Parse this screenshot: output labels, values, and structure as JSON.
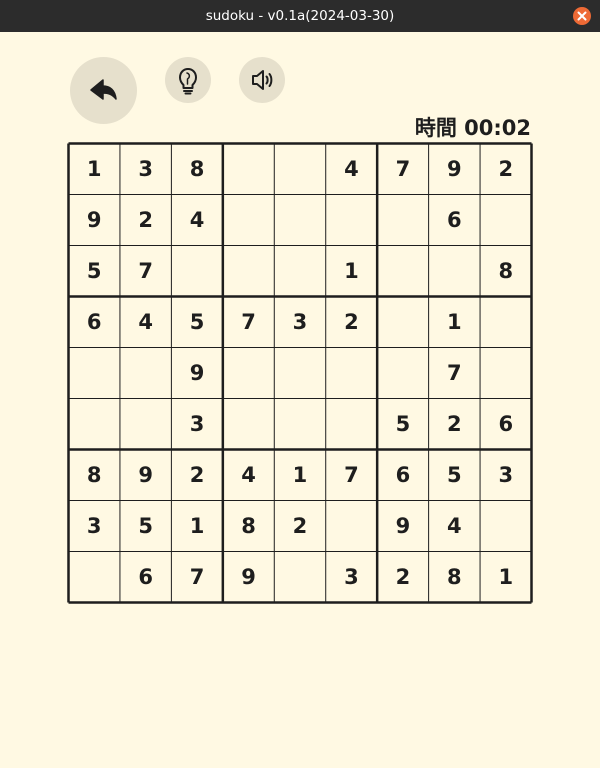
{
  "window": {
    "title": "sudoku - v0.1a(2024-03-30)"
  },
  "toolbar": {
    "back_icon": "undo-arrow-icon",
    "hint_icon": "lightbulb-icon",
    "sound_icon": "speaker-icon"
  },
  "timer": {
    "label": "時間",
    "value": "00:02",
    "display": "時間 00:02"
  },
  "board": {
    "size": 9,
    "rows": [
      [
        "1",
        "3",
        "8",
        "",
        "",
        "4",
        "7",
        "9",
        "2"
      ],
      [
        "9",
        "2",
        "4",
        "",
        "",
        "",
        "",
        "6",
        ""
      ],
      [
        "5",
        "7",
        "",
        "",
        "",
        "1",
        "",
        "",
        "8"
      ],
      [
        "6",
        "4",
        "5",
        "7",
        "3",
        "2",
        "",
        "1",
        ""
      ],
      [
        "",
        "",
        "9",
        "",
        "",
        "",
        "",
        "7",
        ""
      ],
      [
        "",
        "",
        "3",
        "",
        "",
        "",
        "5",
        "2",
        "6"
      ],
      [
        "8",
        "9",
        "2",
        "4",
        "1",
        "7",
        "6",
        "5",
        "3"
      ],
      [
        "3",
        "5",
        "1",
        "8",
        "2",
        "",
        "9",
        "4",
        ""
      ],
      [
        "",
        "6",
        "7",
        "9",
        "",
        "3",
        "2",
        "8",
        "1"
      ]
    ]
  },
  "colors": {
    "background": "#fff9e3",
    "titlebar": "#2c2c2c",
    "close_button": "#ee6a35",
    "button_fill": "#e6e0cc",
    "text": "#1e1e1e"
  }
}
